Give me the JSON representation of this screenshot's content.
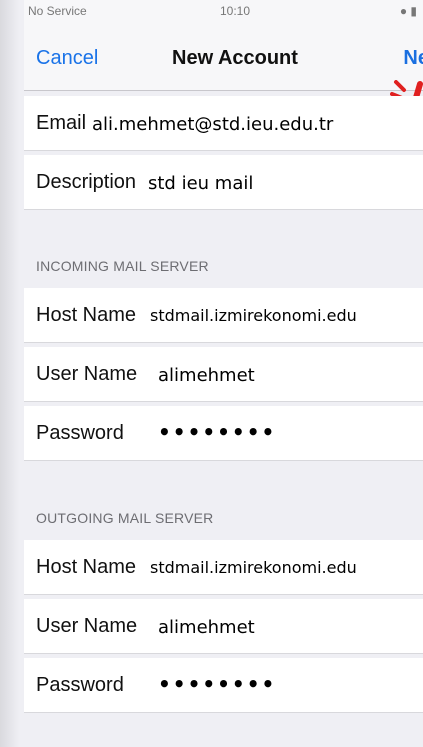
{
  "status_bar": {
    "carrier": "No Service",
    "time": "10:10"
  },
  "nav": {
    "cancel_label": "Cancel",
    "title": "New Account",
    "next_label": "Ne"
  },
  "account": {
    "email": {
      "label": "Email",
      "value": "ali.mehmet@std.ieu.edu.tr"
    },
    "description": {
      "label": "Description",
      "value": "std ieu mail"
    }
  },
  "incoming": {
    "header": "INCOMING MAIL SERVER",
    "host": {
      "label": "Host Name",
      "value": "stdmail.izmirekonomi.edu"
    },
    "user": {
      "label": "User Name",
      "value": "alimehmet"
    },
    "password": {
      "label": "Password",
      "value": "••••••••"
    }
  },
  "outgoing": {
    "header": "OUTGOING MAIL SERVER",
    "host": {
      "label": "Host Name",
      "value": "stdmail.izmirekonomi.edu"
    },
    "user": {
      "label": "User Name",
      "value": "alimehmet"
    },
    "password": {
      "label": "Password",
      "value": "••••••••"
    }
  },
  "colors": {
    "accent": "#1a73e8",
    "annotation": "#e02020"
  }
}
